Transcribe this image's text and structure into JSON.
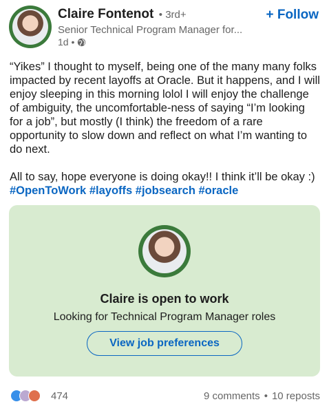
{
  "author": {
    "name": "Claire Fontenot",
    "degree": "• 3rd+",
    "headline": "Senior Technical Program Manager for...",
    "time": "1d •",
    "open_to_work_badge": "#OPENTOWORK"
  },
  "follow_label": "+ Follow",
  "post": {
    "paragraph1": "“Yikes” I thought to myself, being one of the many many folks impacted by recent layoffs at Oracle. But it happens, and I will enjoy sleeping in this morning lolol I will enjoy the challenge of ambiguity, the uncomfortable-ness of saying “I’m looking for a job”, but mostly (I think) the freedom of a rare opportunity to slow down and reflect on what I’m wanting to do next.",
    "paragraph2_text": "All to say, hope  everyone is doing okay!! I think it’ll be okay :) ",
    "hashtags": [
      "#OpenToWork",
      "#layoffs",
      "#jobsearch",
      "#oracle"
    ]
  },
  "card": {
    "title": "Claire is open to work",
    "subtitle": "Looking for Technical Program Manager roles",
    "button_label": "View job preferences",
    "background": "#d8ebd0"
  },
  "footer": {
    "reaction_count": "474",
    "comments": "9 comments",
    "separator": "•",
    "reposts": "10 reposts"
  },
  "colors": {
    "accent": "#0a66c2",
    "open_to_work_green": "#3b7a3b"
  }
}
